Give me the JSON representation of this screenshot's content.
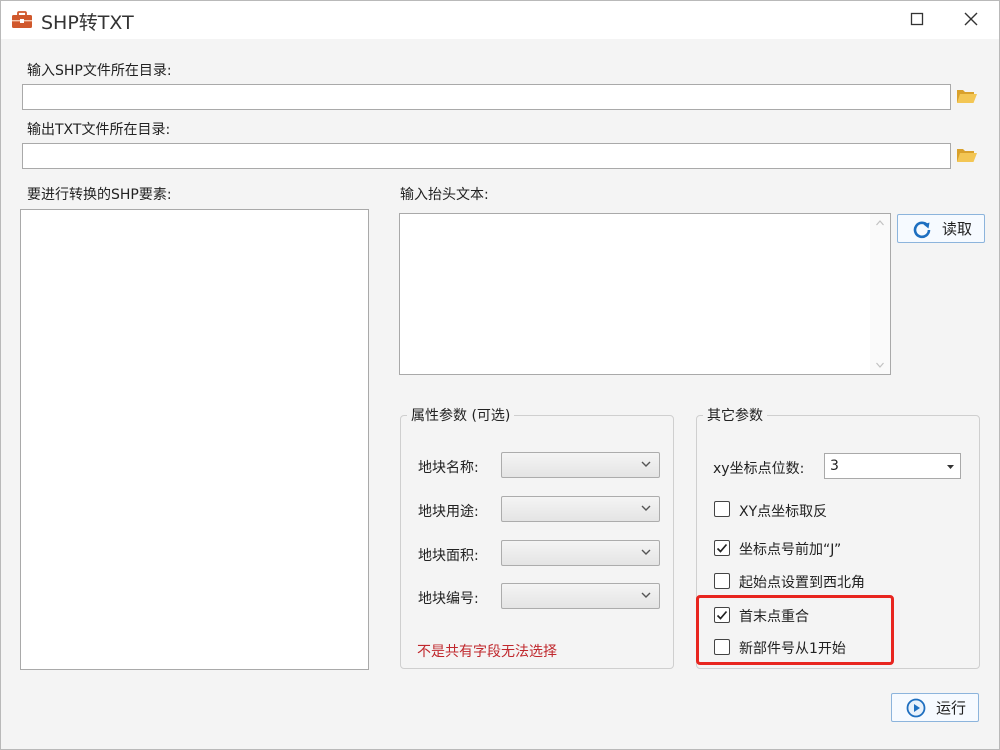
{
  "window": {
    "title": "SHP转TXT",
    "maximize_icon": "maximize-icon",
    "close_icon": "close-icon"
  },
  "input_dir": {
    "label": "输入SHP文件所在目录:",
    "value": "",
    "icon": "folder-open-icon"
  },
  "output_dir": {
    "label": "输出TXT文件所在目录:",
    "value": "",
    "icon": "folder-open-icon"
  },
  "features": {
    "label": "要进行转换的SHP要素:",
    "items": []
  },
  "header_text": {
    "label": "输入抬头文本:",
    "value": ""
  },
  "read_button": {
    "label": "读取",
    "icon": "refresh-icon"
  },
  "attributes": {
    "title": "属性参数 (可选)",
    "fields": [
      {
        "label": "地块名称:",
        "value": ""
      },
      {
        "label": "地块用途:",
        "value": ""
      },
      {
        "label": "地块面积:",
        "value": ""
      },
      {
        "label": "地块编号:",
        "value": ""
      }
    ],
    "warning": "不是共有字段无法选择"
  },
  "other": {
    "title": "其它参数",
    "decimals_label": "xy坐标点位数:",
    "decimals_value": "3",
    "options": [
      {
        "label": "XY点坐标取反",
        "checked": false
      },
      {
        "label": "坐标点号前加“J”",
        "checked": true
      },
      {
        "label": "起始点设置到西北角",
        "checked": false
      },
      {
        "label": "首末点重合",
        "checked": true
      },
      {
        "label": "新部件号从1开始",
        "checked": false
      }
    ]
  },
  "run_button": {
    "label": "运行",
    "icon": "play-icon"
  },
  "colors": {
    "accent": "#1e6fc0",
    "highlight": "#e8251f",
    "warning": "#c0282d",
    "folder": "#e8b33a"
  }
}
